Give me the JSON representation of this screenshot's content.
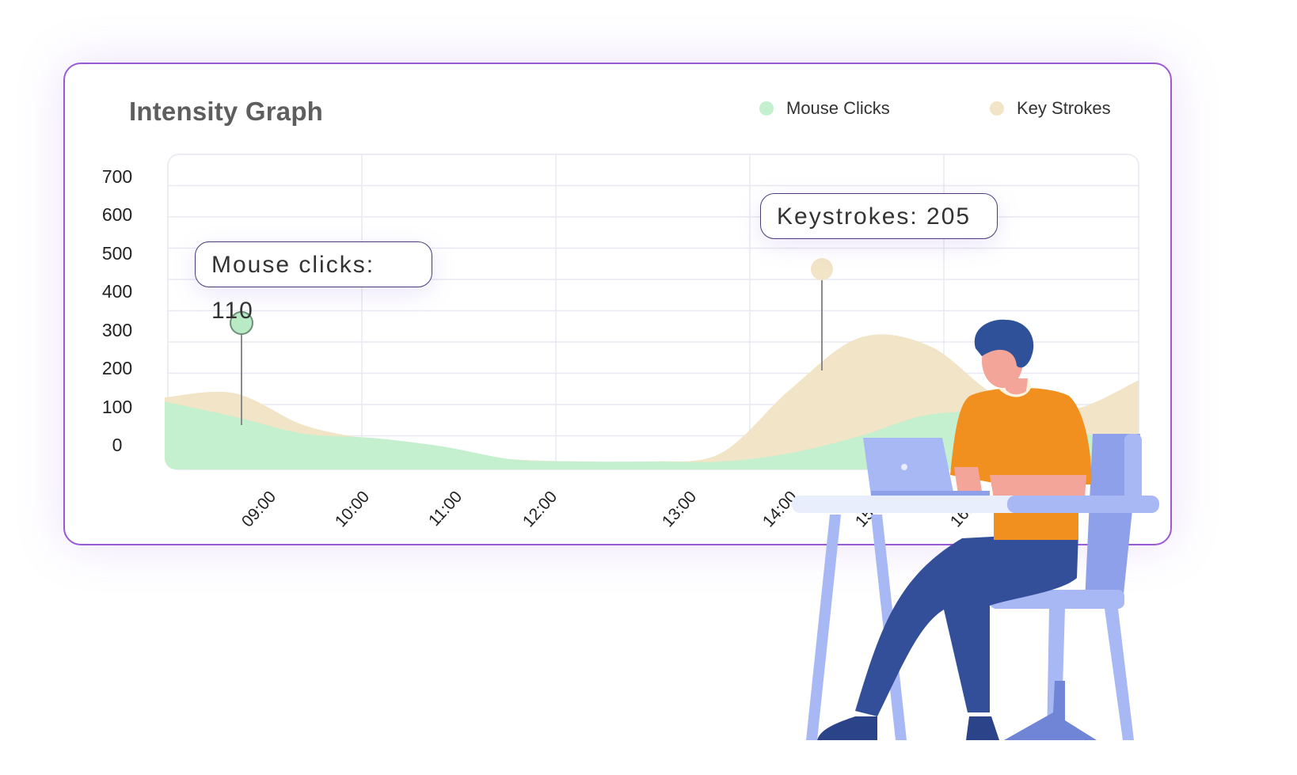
{
  "card": {
    "border_color": "#9b59d6"
  },
  "chart_data": {
    "type": "area",
    "title": "Intensity Graph",
    "xlabel": "",
    "ylabel": "",
    "ylim": [
      0,
      700
    ],
    "yticks": [
      700,
      600,
      500,
      400,
      300,
      200,
      100,
      0
    ],
    "categories": [
      "09:00",
      "10:00",
      "11:00",
      "12:00",
      "13:00",
      "14:00",
      "15:00",
      "16:00"
    ],
    "grid": true,
    "legend_position": "top-right",
    "series": [
      {
        "name": "Key Strokes",
        "color": "#f2e4c6",
        "x": [
          0,
          0.5,
          1.0,
          1.5,
          2.0,
          2.5,
          3.0,
          3.5,
          4.0,
          4.5,
          5.0,
          5.5,
          6.0,
          6.5,
          7.0
        ],
        "values": [
          150,
          160,
          85,
          50,
          20,
          5,
          0,
          0,
          20,
          170,
          290,
          270,
          150,
          120,
          190
        ]
      },
      {
        "name": "Mouse Clicks",
        "color": "#c4f0cf",
        "x": [
          0,
          0.5,
          1.0,
          1.5,
          2.0,
          2.5,
          3.0,
          3.5,
          4.0,
          4.5,
          5.0,
          5.5,
          6.0,
          6.5,
          7.0
        ],
        "values": [
          140,
          105,
          65,
          55,
          35,
          5,
          0,
          0,
          0,
          20,
          60,
          110,
          110,
          70,
          50
        ]
      }
    ],
    "annotations": [
      {
        "label": "Mouse clicks: 110",
        "series": "Mouse Clicks",
        "marker_color": "#b8eac5",
        "x": 0.45
      },
      {
        "label": "Keystrokes: 205",
        "series": "Key Strokes",
        "marker_color": "#f2e4c6",
        "x": 4.7
      }
    ]
  },
  "legend": [
    {
      "label": "Mouse Clicks",
      "color": "#c4f0cf"
    },
    {
      "label": "Key Strokes",
      "color": "#f2e4c6"
    }
  ]
}
